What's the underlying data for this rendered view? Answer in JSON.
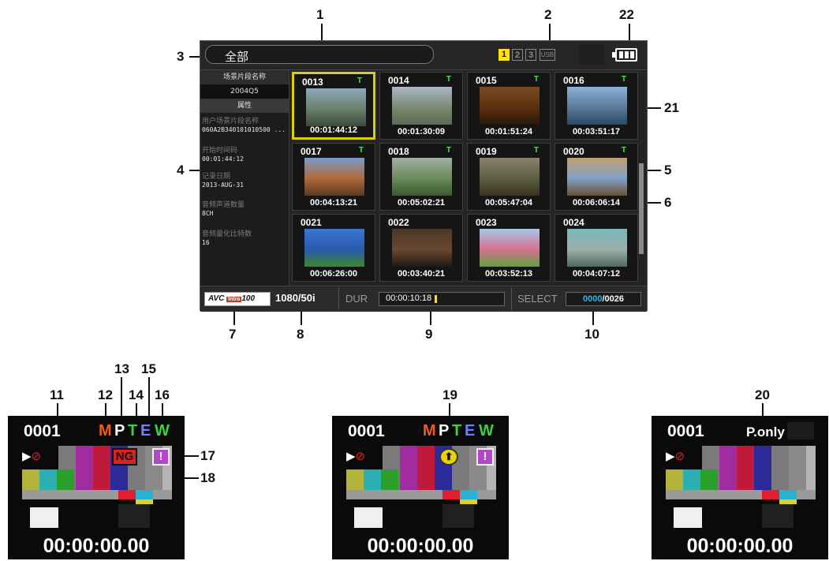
{
  "callouts": [
    "1",
    "2",
    "3",
    "4",
    "5",
    "6",
    "7",
    "8",
    "9",
    "10",
    "11",
    "12",
    "13",
    "14",
    "15",
    "16",
    "17",
    "18",
    "19",
    "20",
    "21",
    "22"
  ],
  "screen": {
    "title": "全部",
    "slots": [
      "1",
      "2",
      "3"
    ],
    "active_slot": "1",
    "usb_label": "USB"
  },
  "properties": {
    "clip_name_header": "场景片段名称",
    "clip_name_value": "2004Q5",
    "attributes_header": "属性",
    "fields": [
      {
        "label": "用户场景片段名称",
        "value": "060A2B340101010500 ..."
      },
      {
        "label": "开始时间码",
        "value": "00:01:44:12"
      },
      {
        "label": "记录日期",
        "value": "2013-AUG-31"
      },
      {
        "label": "音频声道数量",
        "value": "8CH"
      },
      {
        "label": "音频量化比特数",
        "value": "16"
      }
    ]
  },
  "clips": [
    {
      "num": "0013",
      "t": "T",
      "tc": "00:01:44:12",
      "colors": [
        "#8fa8b8",
        "#6a7f6a",
        "#3a4a3a"
      ],
      "selected": true
    },
    {
      "num": "0014",
      "t": "T",
      "tc": "00:01:30:09",
      "colors": [
        "#aab8c8",
        "#7a8a70",
        "#5a6a50"
      ]
    },
    {
      "num": "0015",
      "t": "T",
      "tc": "00:01:51:24",
      "colors": [
        "#7a4a20",
        "#5a3010",
        "#2a1808"
      ]
    },
    {
      "num": "0016",
      "t": "T",
      "tc": "00:03:51:17",
      "colors": [
        "#8ab4d8",
        "#5a7898",
        "#2a4868"
      ]
    },
    {
      "num": "0017",
      "t": "T",
      "tc": "00:04:13:21",
      "colors": [
        "#7a9cc8",
        "#b06838",
        "#5a3a20"
      ]
    },
    {
      "num": "0018",
      "t": "T",
      "tc": "00:05:02:21",
      "colors": [
        "#a0b0a0",
        "#6a8a5a",
        "#3a5a30"
      ]
    },
    {
      "num": "0019",
      "t": "T",
      "tc": "00:05:47:04",
      "colors": [
        "#8a8070",
        "#5a6040",
        "#3a3020"
      ]
    },
    {
      "num": "0020",
      "t": "T",
      "tc": "00:06:06:14",
      "colors": [
        "#c0a070",
        "#80a0c8",
        "#6a5030"
      ]
    },
    {
      "num": "0021",
      "t": "",
      "tc": "00:06:26:00",
      "colors": [
        "#3a78d0",
        "#2a58b0",
        "#3a8a2a"
      ]
    },
    {
      "num": "0022",
      "t": "",
      "tc": "00:03:40:21",
      "colors": [
        "#4a3828",
        "#6a4830",
        "#201810"
      ]
    },
    {
      "num": "0023",
      "t": "",
      "tc": "00:03:52:13",
      "colors": [
        "#a8c8e8",
        "#d87090",
        "#60a040"
      ]
    },
    {
      "num": "0024",
      "t": "",
      "tc": "00:04:07:12",
      "colors": [
        "#7ab8b8",
        "#9ab0a8",
        "#506a60"
      ]
    }
  ],
  "bottom": {
    "codec": "AVC",
    "codec_mark": "Intra",
    "codec_rate": "100",
    "format": "1080/50i",
    "dur_label": "DUR",
    "dur_value": "00:00:10:18",
    "select_label": "SELECT",
    "select_current": "0000",
    "select_total": "/0026"
  },
  "zooms": [
    {
      "num": "0001",
      "tc": "00:00:00.00",
      "ng": "NG",
      "ex": "!",
      "ind": [
        "M",
        "P",
        "T",
        "E",
        "W"
      ]
    },
    {
      "num": "0001",
      "tc": "00:00:00.00",
      "ex": "!",
      "up": "⬆",
      "ind": [
        "M",
        "P",
        "T",
        "E",
        "W"
      ]
    },
    {
      "num": "0001",
      "tc": "00:00:00.00",
      "ponly": "P.only"
    }
  ],
  "colors": {
    "indicator_m": "#f05a1e",
    "indicator_p": "#ffffff",
    "indicator_t": "#3fd03f",
    "indicator_e": "#6f7fff",
    "indicator_w": "#3fd03f",
    "selection": "#d9d000",
    "select_current": "#34b5e0"
  }
}
